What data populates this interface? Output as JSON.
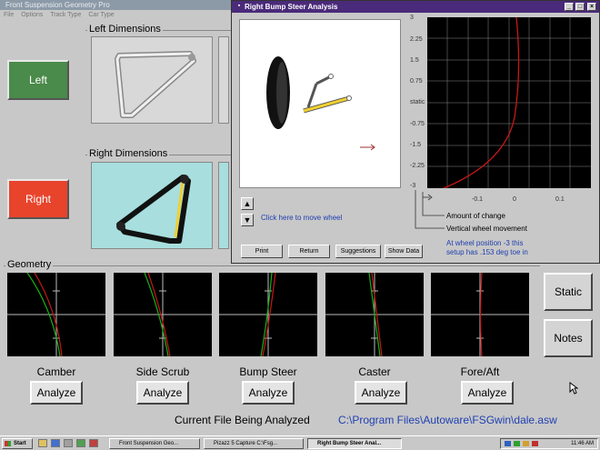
{
  "main_window": {
    "title": "Front Suspension Geometry Pro",
    "menu": [
      "File",
      "Options",
      "Track Type",
      "Car Type"
    ]
  },
  "left_button": "Left",
  "right_button": "Right",
  "left_dimensions_label": "Left Dimensions",
  "right_dimensions_label": "Right Dimensions",
  "geometry": {
    "label": "Geometry",
    "plots": [
      {
        "label": "Camber",
        "button": "Analyze"
      },
      {
        "label": "Side Scrub",
        "button": "Analyze"
      },
      {
        "label": "Bump Steer",
        "button": "Analyze"
      },
      {
        "label": "Caster",
        "button": "Analyze"
      },
      {
        "label": "Fore/Aft",
        "button": "Analyze"
      }
    ]
  },
  "static_button": "Static",
  "notes_button": "Notes",
  "current_file": {
    "label": "Current File Being Analyzed",
    "path": "C:\\Program Files\\Autoware\\FSGwin\\dale.asw"
  },
  "dialog": {
    "title": "Right Bump Steer Analysis",
    "move_wheel_link": "Click here to move wheel",
    "buttons": {
      "print": "Print",
      "return": "Return",
      "suggestions": "Suggestions",
      "show_data": "Show Data"
    },
    "y_ticks": [
      "3",
      "2.25",
      "1.5",
      "0.75",
      "static",
      "-0.75",
      "-1.5",
      "-2.25",
      "-3"
    ],
    "x_ticks": [
      "-0.1",
      "0",
      "0.1"
    ],
    "legend_change": "Amount of change",
    "legend_vertical": "Vertical wheel movement",
    "result_line1": "At wheel position -3 this",
    "result_line2": "setup has .153 deg toe in"
  },
  "taskbar": {
    "start": "Start",
    "items": [
      "Front Suspension Geo...",
      "Pizazz 5 Capture C:\\Fsg...",
      "Right Bump Steer Anal..."
    ],
    "clock": "11:46 AM"
  },
  "colors": {
    "left_button": "#4a8a4a",
    "right_button": "#e8442c",
    "dialog_titlebar": "#4a2a7a",
    "link_blue": "#2040b0",
    "curve_red": "#c81818",
    "curve_green": "#18b018"
  }
}
